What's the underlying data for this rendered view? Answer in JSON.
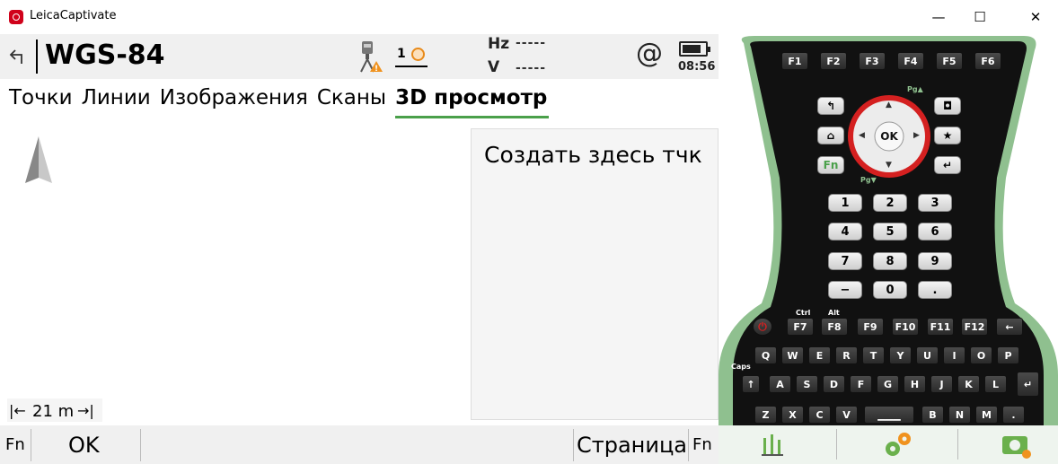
{
  "window": {
    "title": "LeicaCaptivate",
    "min": "—",
    "max": "☐",
    "close": "✕"
  },
  "header": {
    "back_icon": "back-arrow-icon",
    "title": "WGS-84",
    "satellites": "1",
    "hz_label": "Hz",
    "hz_value": "-----",
    "v_label": "V",
    "v_value": "-----",
    "at_symbol": "@",
    "battery_level": 0.85,
    "clock": "08:56"
  },
  "tabs": [
    {
      "label": "Точки",
      "active": false
    },
    {
      "label": "Линии",
      "active": false
    },
    {
      "label": "Изображения",
      "active": false
    },
    {
      "label": "Сканы",
      "active": false
    },
    {
      "label": "3D просмотр",
      "active": true
    }
  ],
  "map": {
    "scale_label": "21 m",
    "context_item": "Создать здесь тчк"
  },
  "softkeys": {
    "fn_left": "Fn",
    "ok": "OK",
    "page": "Страница",
    "fn_right": "Fn"
  },
  "keypad": {
    "fkeys": [
      "F1",
      "F2",
      "F3",
      "F4",
      "F5",
      "F6"
    ],
    "ok": "OK",
    "fn": "Fn",
    "numpad": [
      "1",
      "2",
      "3",
      "4",
      "5",
      "6",
      "7",
      "8",
      "9",
      "−",
      "0",
      "."
    ],
    "fkeys2": [
      "F7",
      "F8",
      "F9",
      "F10",
      "F11",
      "F12"
    ],
    "fkeys2_labels": {
      "ctrl": "Ctrl",
      "alt": "Alt"
    },
    "row1": [
      "Q",
      "W",
      "E",
      "R",
      "T",
      "Y",
      "U",
      "I",
      "O",
      "P"
    ],
    "row1_syms": [
      "@",
      "!",
      "$",
      "%",
      "&",
      "(",
      ")",
      "=",
      "?",
      ""
    ],
    "row2": [
      "A",
      "S",
      "D",
      "F",
      "G",
      "H",
      "J",
      "K",
      "L"
    ],
    "row3": [
      "Z",
      "X",
      "C",
      "V",
      "B",
      "N",
      "M",
      "."
    ],
    "caps": "Caps",
    "pg_up": "Pg▲",
    "pg_down": "Pg▼"
  },
  "colors": {
    "accent_green": "#4aa04a",
    "device_green": "#8fc08f",
    "brand_red": "#d0021b",
    "ok_ring": "#d42020"
  }
}
